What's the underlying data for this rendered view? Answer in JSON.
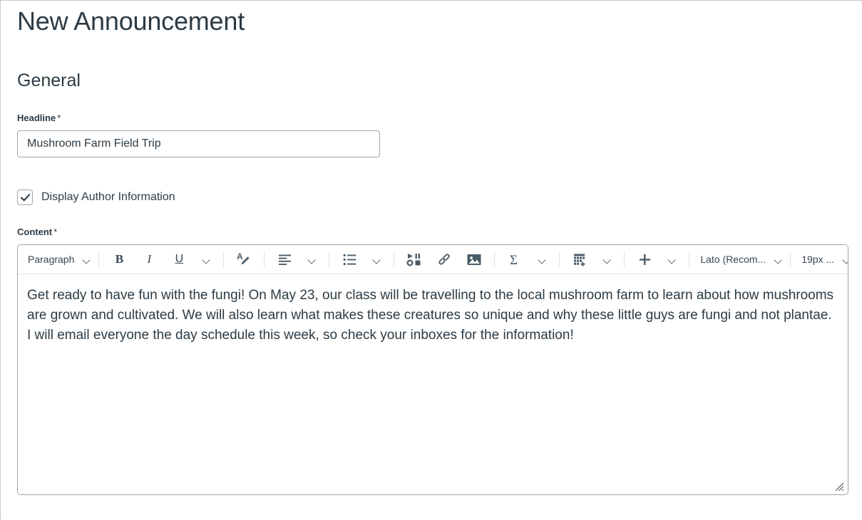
{
  "page": {
    "title": "New Announcement",
    "section_title": "General"
  },
  "headline": {
    "label": "Headline",
    "required_marker": "*",
    "value": "Mushroom Farm Field Trip"
  },
  "display_author": {
    "label": "Display Author Information",
    "checked": true,
    "check_icon": "check-icon"
  },
  "content": {
    "label": "Content",
    "required_marker": "*",
    "body_text": "Get ready to have fun with the fungi! On May 23, our class will be travelling to the local mushroom farm to learn about how mushrooms are grown and cultivated. We will also learn what makes these creatures so unique and why these little guys are fungi and not plantae. I will email everyone the day schedule this week, so check your inboxes for the information!"
  },
  "toolbar": {
    "block_format": "Paragraph",
    "bold": "B",
    "italic": "I",
    "underline": "U",
    "font_family": "Lato (Recom...",
    "font_size": "19px ...",
    "icons": {
      "text_color": "text-color-icon",
      "align": "align-left-icon",
      "list": "bulleted-list-icon",
      "media": "media-icon",
      "link": "link-icon",
      "image": "image-icon",
      "equation": "equation-sigma-icon",
      "table": "insert-table-icon",
      "plus": "insert-more-plus-icon",
      "overflow": "overflow-menu-icon",
      "fullscreen": "fullscreen-expand-icon",
      "resize": "resize-grip-icon"
    }
  },
  "colors": {
    "text": "#2d3b45",
    "border": "#9ea6ad",
    "icon": "#4a5b68",
    "divider": "#e3e5e7"
  }
}
